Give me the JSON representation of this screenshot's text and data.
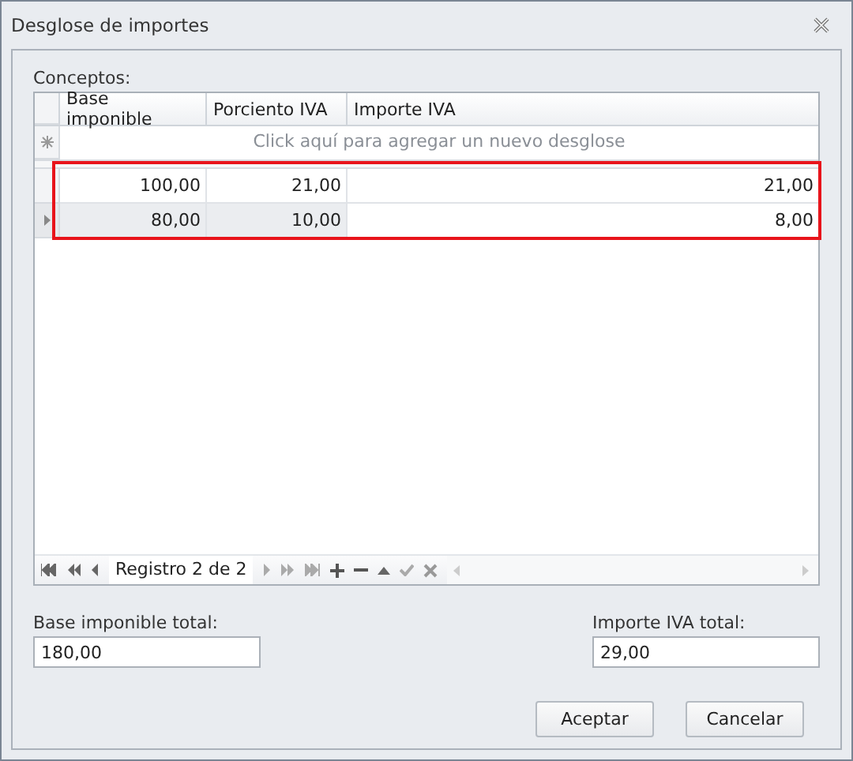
{
  "window": {
    "title": "Desglose de importes"
  },
  "grid": {
    "label": "Conceptos:",
    "columns": [
      "Base imponible",
      "Porciento IVA",
      "Importe IVA"
    ],
    "new_row_hint": "Click aquí para agregar un nuevo desglose",
    "rows": [
      {
        "cells": [
          "100,00",
          "21,00",
          "21,00"
        ],
        "selected": false
      },
      {
        "cells": [
          "80,00",
          "10,00",
          "8,00"
        ],
        "selected": true
      }
    ],
    "navigator": "Registro 2 de 2"
  },
  "totals": [
    {
      "label": "Base imponible total:",
      "value": "180,00"
    },
    {
      "label": "Importe IVA total:",
      "value": "29,00"
    }
  ],
  "buttons": [
    "Aceptar",
    "Cancelar"
  ]
}
